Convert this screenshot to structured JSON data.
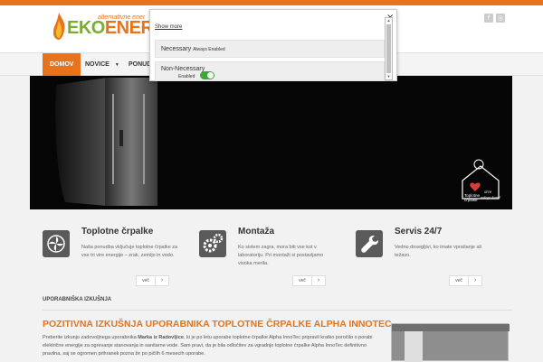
{
  "header": {
    "logo_text_1": "EKO",
    "logo_text_2": "ENERGIJ",
    "tagline": "alternativne ener",
    "social": [
      {
        "icon": "facebook-icon",
        "label": "f"
      },
      {
        "icon": "rss-icon",
        "label": "◎"
      }
    ]
  },
  "nav": {
    "items": [
      {
        "label": "DOMOV",
        "active": true
      },
      {
        "label": "NOVICE",
        "dropdown": true
      },
      {
        "label": "PONUD",
        "dropdown": false
      }
    ]
  },
  "consent": {
    "close": "×",
    "show_more": "Show more",
    "necessary_label": "Necessary",
    "necessary_sub": "Always Enabled",
    "nonnecessary_label": "Non-Necessary",
    "enabled_label": "Enabled",
    "toggle_on": true
  },
  "hero": {
    "house_caption_1": "Toplotne",
    "house_caption_2": "črpalke",
    "house_caption_3": "srce",
    "house_caption_4": "vašega doma!"
  },
  "features": [
    {
      "icon": "fan-icon",
      "title": "Toplotne črpalke",
      "text": "Naša ponudba vključuje toplotne črpalke za vse tri vire energije – zrak, zemljo in vodo.",
      "more": "več",
      "arrow": "›"
    },
    {
      "icon": "gears-icon",
      "title": "Montaža",
      "text": "Ko sistem zagra, mora biti vse kot v laboratoriju. Pri montaži si postavljamo visoka merila.",
      "more": "več",
      "arrow": "›"
    },
    {
      "icon": "wrench-icon",
      "title": "Servis 24/7",
      "text": "Vedno dosegljivi, ko imate vprašanje ali težavo.",
      "more": "več",
      "arrow": "›"
    }
  ],
  "section": {
    "label": "UPORABNIŠKA IZKUŠNJA"
  },
  "article": {
    "title": "POZITIVNA IZKUŠNJA UPORABNIKA TOPLOTNE ČRPALKE ALPHA INNOTEC",
    "body_1": "Preberite izkunjo zadovoljnega uporabnika ",
    "body_bold": "Marka iz Radovljice",
    "body_2": ", ki je po letu uporabe toplotne črpalke Alpha InnoTec pripravil kratko poročilo o porabi električne energije za ogrevanje stanovanja in sanitarne vode. Sam pravi, da je bila odločitev za vgradnjo toplotne črpalke Alpha InnoTec definitivno pravilna, saj se ogromen prihranek pozna že po pičlih 6 mesecih uporabe."
  },
  "colors": {
    "accent": "#e8731a",
    "green": "#7bab33",
    "toggle": "#3aaa35"
  }
}
